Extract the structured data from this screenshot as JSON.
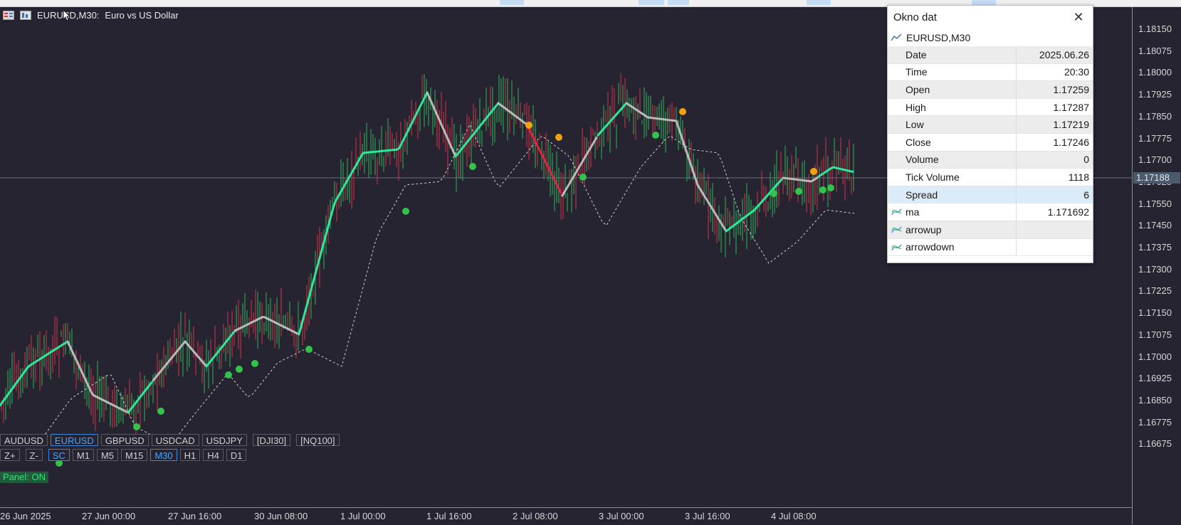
{
  "chart": {
    "symbol_title": "EURUSD,M30:",
    "description": "Euro vs US Dollar",
    "colors": {
      "background": "#262431",
      "bull_candle": "#2fb55b",
      "bear_candle": "#d6324b",
      "ma_up": "#2ee89a",
      "ma_flat": "#b9b9b9",
      "ma_down": "#e6213f",
      "slow_ma": "#e0e0e0",
      "arrow_up": "#33c24a",
      "arrow_down": "#f2a20c"
    }
  },
  "price_axis": {
    "labels": [
      "1.18150",
      "1.18075",
      "1.18000",
      "1.17925",
      "1.17850",
      "1.17775",
      "1.17700",
      "1.17625",
      "1.17550",
      "1.17450",
      "1.17375",
      "1.17300",
      "1.17225",
      "1.17150",
      "1.17075",
      "1.17000",
      "1.16925",
      "1.16850",
      "1.16775",
      "1.16675"
    ],
    "current_price": "1.17188"
  },
  "time_axis": {
    "labels": [
      "26 Jun 2025",
      "27 Jun 00:00",
      "27 Jun 16:00",
      "30 Jun 08:00",
      "1 Jul 00:00",
      "1 Jul 16:00",
      "2 Jul 08:00",
      "3 Jul 00:00",
      "3 Jul 16:00",
      "4 Jul 08:00"
    ]
  },
  "symbol_panel": {
    "symbols": [
      "AUDUSD",
      "EURUSD",
      "GBPUSD",
      "USDCAD",
      "USDJPY",
      "[DJI30]",
      "[NQ100]"
    ],
    "active_symbol": "EURUSD",
    "controls": [
      "Z+",
      "Z-",
      "SC"
    ],
    "active_control": "SC",
    "timeframes": [
      "M1",
      "M5",
      "M15",
      "M30",
      "H1",
      "H4",
      "D1"
    ],
    "active_timeframe": "M30",
    "status": "Panel: ON"
  },
  "data_window": {
    "title": "Okno dat",
    "symbol": "EURUSD,M30",
    "rows": [
      {
        "key": "Date",
        "value": "2025.06.26"
      },
      {
        "key": "Time",
        "value": "20:30"
      },
      {
        "key": "Open",
        "value": "1.17259"
      },
      {
        "key": "High",
        "value": "1.17287"
      },
      {
        "key": "Low",
        "value": "1.17219"
      },
      {
        "key": "Close",
        "value": "1.17246"
      },
      {
        "key": "Volume",
        "value": "0"
      },
      {
        "key": "Tick Volume",
        "value": "1118"
      },
      {
        "key": "Spread",
        "value": "6"
      }
    ],
    "indicators": [
      {
        "key": "ma",
        "value": "1.171692"
      },
      {
        "key": "arrowup",
        "value": ""
      },
      {
        "key": "arrowdown",
        "value": ""
      }
    ]
  }
}
